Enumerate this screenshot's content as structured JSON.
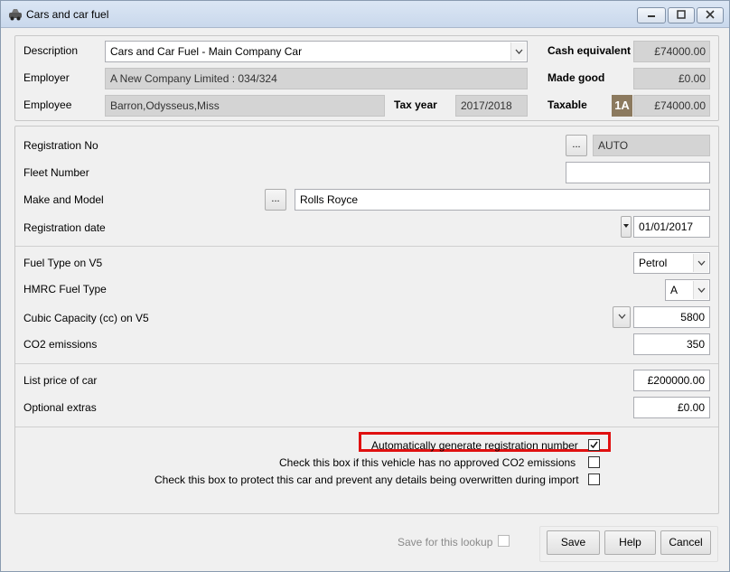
{
  "window": {
    "title": "Cars and car fuel",
    "minimize": "▭",
    "maximize": "▣",
    "close": "✕"
  },
  "header": {
    "description_label": "Description",
    "description_value": "Cars and Car Fuel - Main Company Car",
    "employer_label": "Employer",
    "employer_value": "A New Company Limited : 034/324",
    "employee_label": "Employee",
    "employee_value": "Barron,Odysseus,Miss",
    "tax_year_label": "Tax year",
    "tax_year_value": "2017/2018",
    "cash_equivalent_label": "Cash equivalent",
    "cash_equivalent_value": "£74000.00",
    "made_good_label": "Made good",
    "made_good_value": "£0.00",
    "taxable_label": "Taxable",
    "taxable_badge": "1A",
    "taxable_value": "£74000.00"
  },
  "vehicle": {
    "registration_no_label": "Registration No",
    "registration_no_button": "...",
    "registration_no_value": "AUTO",
    "fleet_number_label": "Fleet Number",
    "fleet_number_value": "",
    "make_model_label": "Make and Model",
    "make_model_button": "...",
    "make_model_value": "Rolls Royce",
    "registration_date_label": "Registration date",
    "registration_date_value": "01/01/2017"
  },
  "fuel": {
    "fuel_type_label": "Fuel Type on V5",
    "fuel_type_value": "Petrol",
    "hmrc_fuel_type_label": "HMRC Fuel Type",
    "hmrc_fuel_type_value": "A",
    "cubic_capacity_label": "Cubic Capacity (cc) on V5",
    "cubic_capacity_value": "5800",
    "co2_label": "CO2 emissions",
    "co2_value": "350"
  },
  "price": {
    "list_price_label": "List price of car",
    "list_price_value": "£200000.00",
    "optional_extras_label": "Optional extras",
    "optional_extras_value": "£0.00"
  },
  "options": {
    "auto_reg_label": "Automatically generate registration number",
    "auto_reg_checked": "✓",
    "no_co2_label": "Check this box if this vehicle has no approved CO2 emissions",
    "protect_label": "Check this box to protect this car and prevent any details being overwritten during import"
  },
  "footer": {
    "save_lookup_label": "Save for this lookup",
    "save_button": "Save",
    "help_button": "Help",
    "cancel_button": "Cancel"
  },
  "icons": {
    "dropdown_arrow": "⌵",
    "app_icon": "car-icon"
  },
  "colors": {
    "highlight": "#e01010",
    "badge": "#8c7a5f",
    "readonly_field": "#d4d4d4"
  }
}
